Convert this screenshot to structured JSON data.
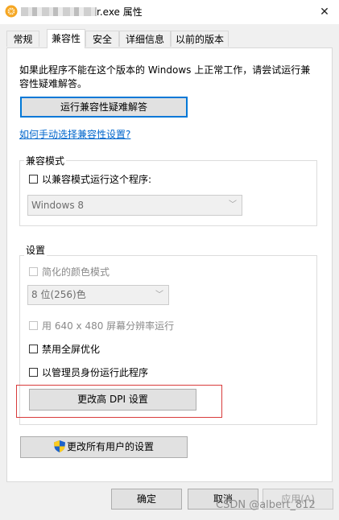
{
  "window": {
    "title_suffix": "r.exe 属性",
    "close_glyph": "✕",
    "app_icon": "orange-circle-icon"
  },
  "tabs": [
    {
      "label": "常规"
    },
    {
      "label": "兼容性",
      "active": true
    },
    {
      "label": "安全"
    },
    {
      "label": "详细信息"
    },
    {
      "label": "以前的版本"
    }
  ],
  "compat": {
    "intro_line1": "如果此程序不能在这个版本的 Windows 上正常工作，请尝试运行兼",
    "intro_line2": "容性疑难解答。",
    "troubleshoot_button": "运行兼容性疑难解答",
    "manual_link": "如何手动选择兼容性设置?",
    "mode_group": {
      "label": "兼容模式",
      "checkbox_label": "以兼容模式运行这个程序:",
      "os_select_value": "Windows 8"
    },
    "settings_group": {
      "label": "设置",
      "reduced_color_label": "简化的颜色模式",
      "color_select_value": "8 位(256)色",
      "resolution_label": "用 640 x 480 屏幕分辨率运行",
      "disable_fullscreen_label": "禁用全屏优化",
      "run_as_admin_label": "以管理员身份运行此程序",
      "dpi_button": "更改高 DPI 设置"
    },
    "all_users_button": "更改所有用户的设置"
  },
  "footer": {
    "ok": "确定",
    "cancel": "取消",
    "apply": "应用(A)"
  },
  "watermark": "CSDN @albert_812",
  "colors": {
    "focus_border": "#0078d7",
    "link": "#0066cc",
    "highlight_box": "#d83b3b"
  }
}
